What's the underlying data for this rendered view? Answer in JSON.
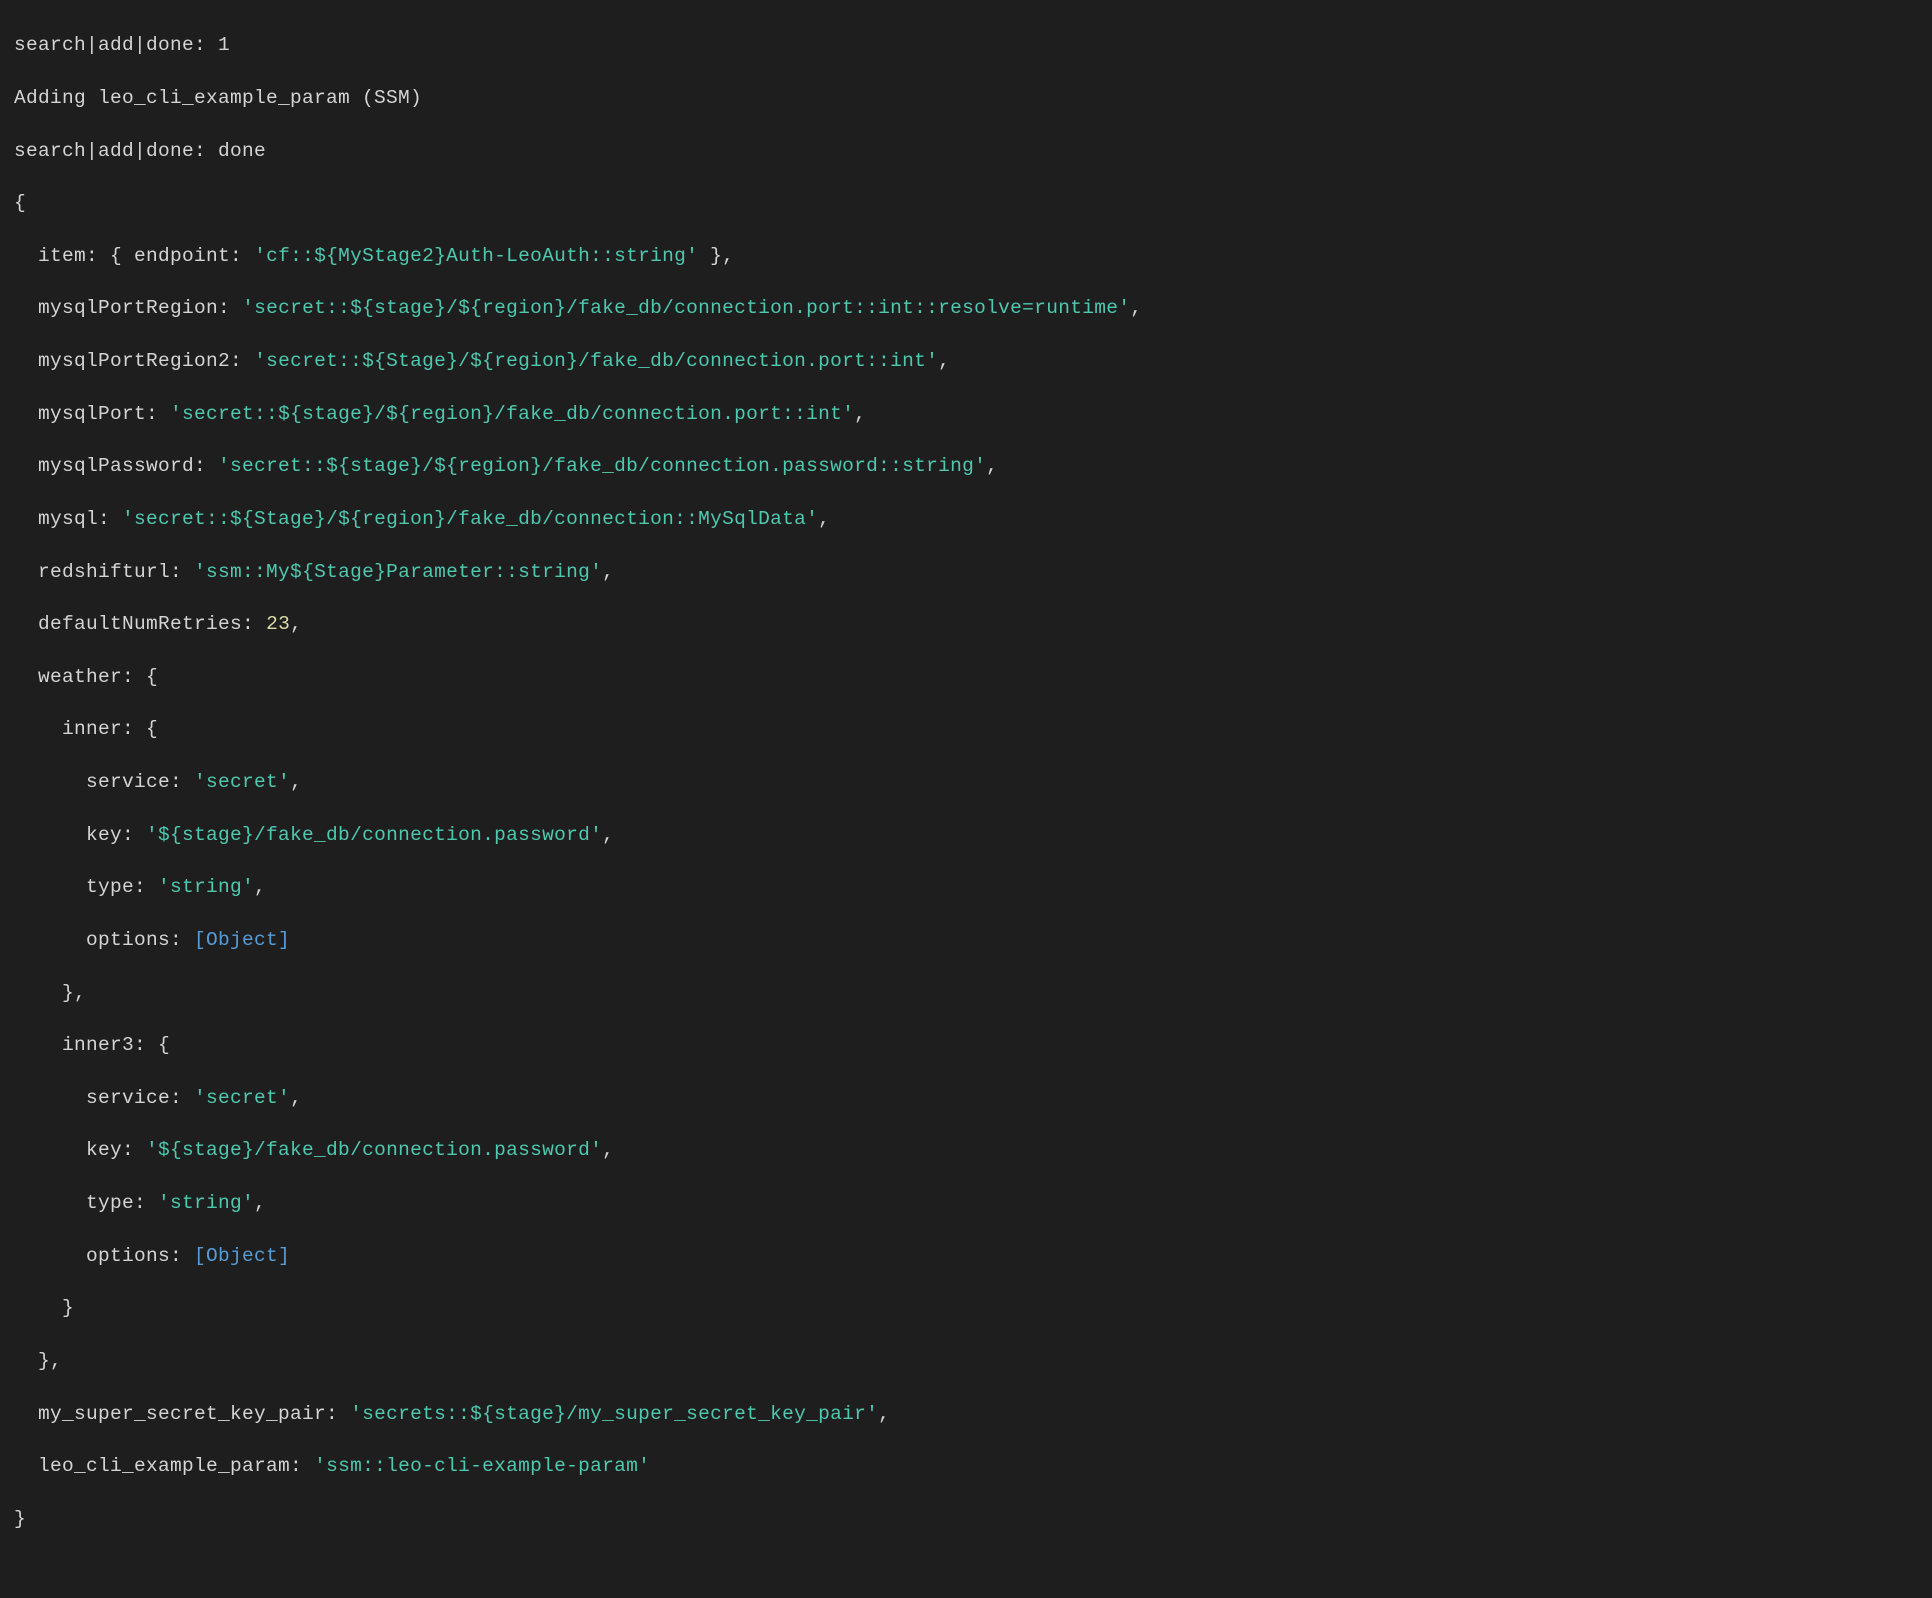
{
  "lines": {
    "l1": "search|add|done: 1",
    "l2": "Adding leo_cli_example_param (SSM)",
    "l3": "search|add|done: done",
    "l4": "{"
  },
  "indent1": "  ",
  "indent2": "    ",
  "indent3": "      ",
  "obj": {
    "item_key": "item: ",
    "item_open": "{ endpoint: ",
    "item_val": "'cf::${MyStage2}Auth-LeoAuth::string'",
    "item_close": " },",
    "mysqlPortRegion_key": "mysqlPortRegion: ",
    "mysqlPortRegion_val": "'secret::${stage}/${region}/fake_db/connection.port::int::resolve=runtime'",
    "mysqlPortRegion2_key": "mysqlPortRegion2: ",
    "mysqlPortRegion2_val": "'secret::${Stage}/${region}/fake_db/connection.port::int'",
    "mysqlPort_key": "mysqlPort: ",
    "mysqlPort_val": "'secret::${stage}/${region}/fake_db/connection.port::int'",
    "mysqlPassword_key": "mysqlPassword: ",
    "mysqlPassword_val": "'secret::${stage}/${region}/fake_db/connection.password::string'",
    "mysql_key": "mysql: ",
    "mysql_val": "'secret::${Stage}/${region}/fake_db/connection::MySqlData'",
    "redshifturl_key": "redshifturl: ",
    "redshifturl_val": "'ssm::My${Stage}Parameter::string'",
    "defaultNumRetries_key": "defaultNumRetries: ",
    "defaultNumRetries_val": "23",
    "weather_key": "weather: {",
    "inner_key": "inner: {",
    "inner3_key": "inner3: {",
    "service_key": "service: ",
    "service_val": "'secret'",
    "key_key": "key: ",
    "key_val": "'${stage}/fake_db/connection.password'",
    "type_key": "type: ",
    "type_val": "'string'",
    "options_key": "options: ",
    "options_val": "[Object]",
    "close_brace_comma": "},",
    "close_brace": "}",
    "my_super_secret_key_pair_key": "my_super_secret_key_pair: ",
    "my_super_secret_key_pair_val": "'secrets::${stage}/my_super_secret_key_pair'",
    "leo_cli_example_param_key": "leo_cli_example_param: ",
    "leo_cli_example_param_val": "'ssm::leo-cli-example-param'"
  },
  "punct": {
    "comma": ","
  }
}
